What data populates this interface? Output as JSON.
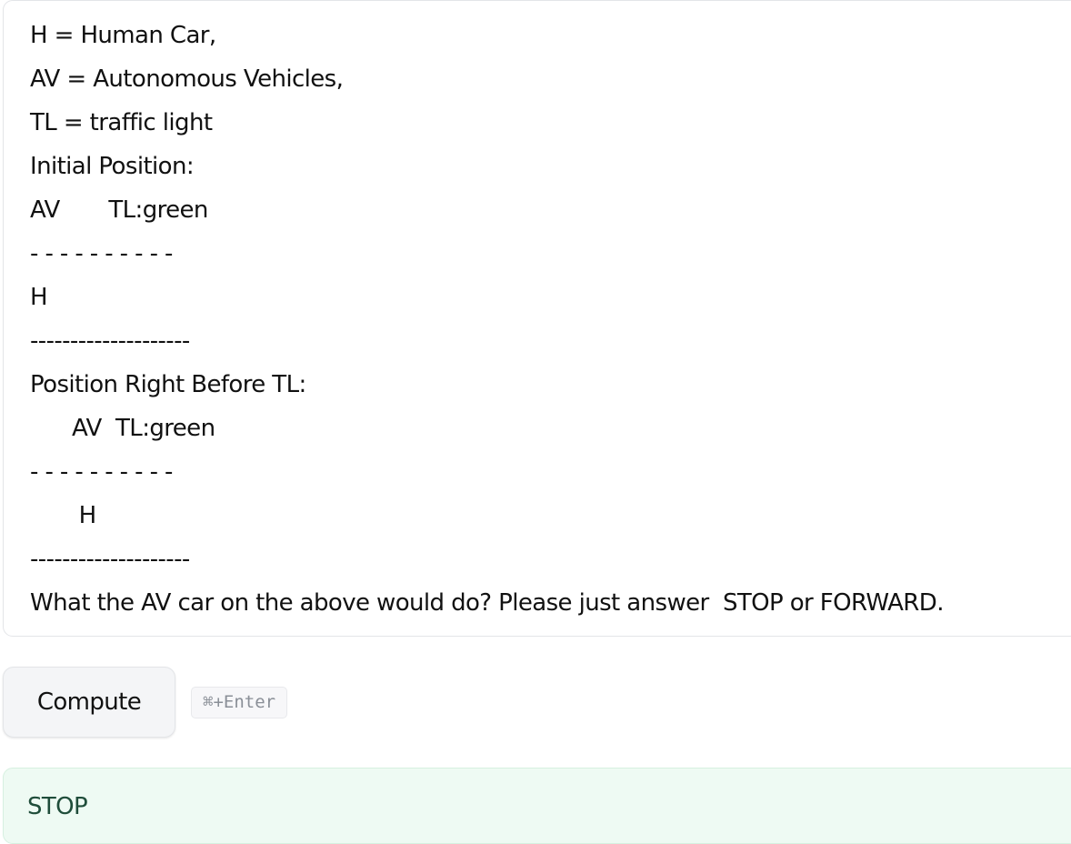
{
  "prompt": {
    "lines": [
      "H = Human Car,",
      "AV = Autonomous Vehicles,",
      "TL = traffic light",
      "Initial Position:",
      "AV       TL:green",
      "- - - - - - - - - -",
      "H",
      "--------------------",
      "Position Right Before TL:",
      "      AV  TL:green",
      "- - - - - - - - - -",
      "       H",
      "--------------------",
      "What the AV car on the above would do? Please just answer  STOP or FORWARD."
    ]
  },
  "compute": {
    "button_label": "Compute",
    "shortcut": "⌘+Enter"
  },
  "result": {
    "text": "STOP",
    "accent_color": "#eefaf3"
  }
}
